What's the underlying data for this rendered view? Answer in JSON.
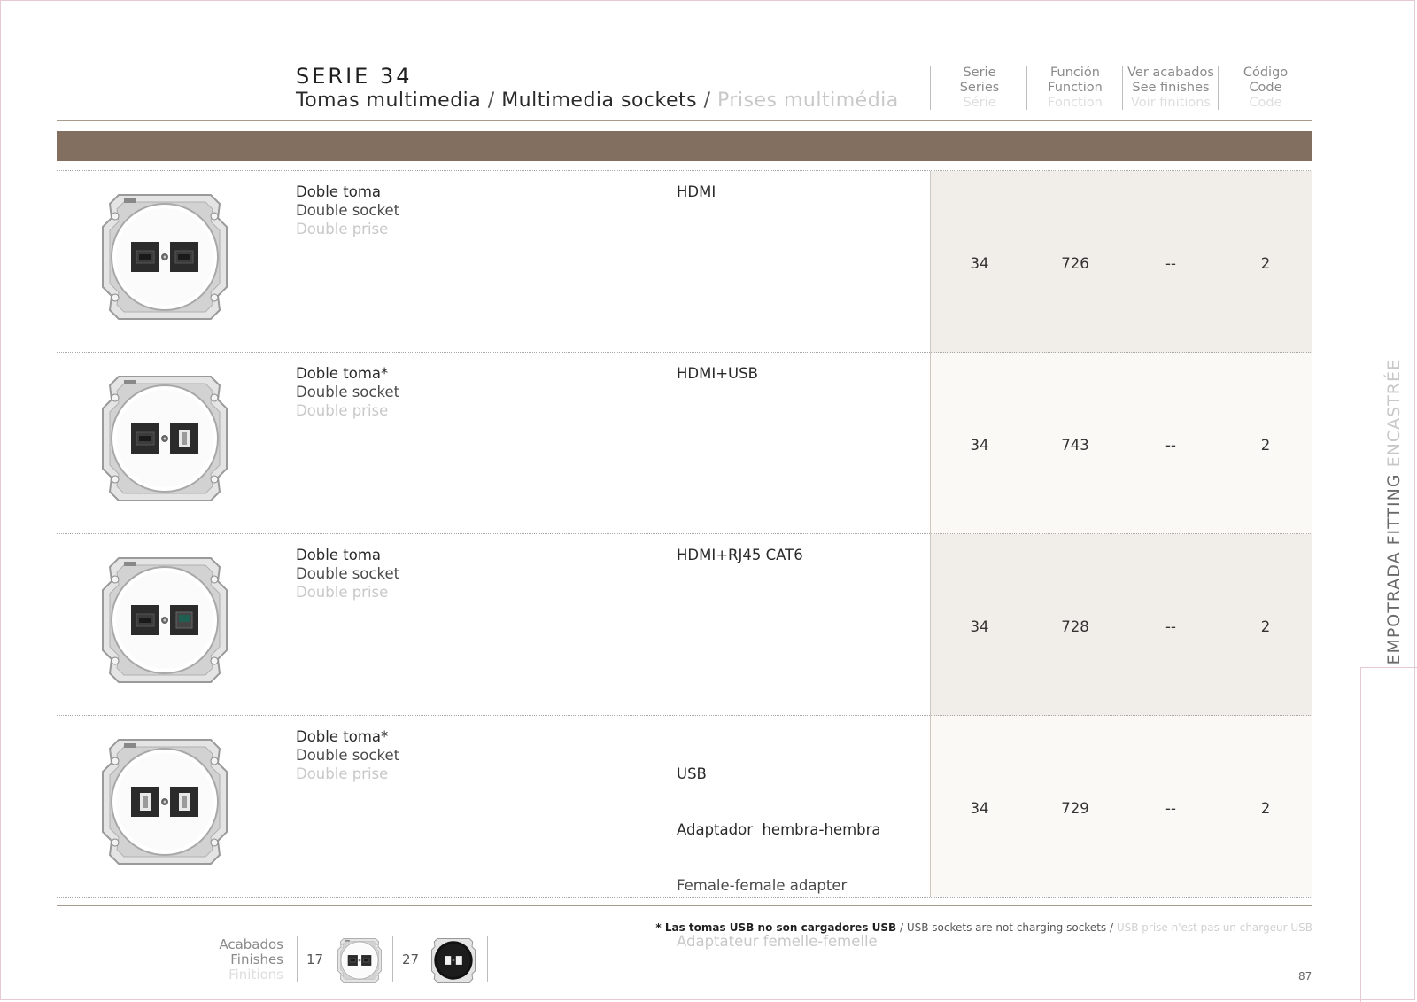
{
  "header": {
    "serie": "SERIE 34",
    "subtitle_es": "Tomas multimedia",
    "subtitle_en": "Multimedia sockets",
    "subtitle_fr": "Prises multimédia",
    "separator": "/",
    "columns": [
      {
        "l1": "Serie",
        "l2": "Series",
        "l3": "Série"
      },
      {
        "l1": "Función",
        "l2": "Function",
        "l3": "Fonction"
      },
      {
        "l1": "Ver acabados",
        "l2": "See finishes",
        "l3": "Voir finitions"
      },
      {
        "l1": "Código",
        "l2": "Code",
        "l3": "Code"
      }
    ]
  },
  "rows": [
    {
      "desc_es": "Doble toma",
      "desc_en": "Double socket",
      "desc_fr": "Double prise",
      "func_l1": "HDMI",
      "func_l2": "",
      "func_l3": "",
      "func_l4": "",
      "serie": "34",
      "funcion": "726",
      "acabados": "--",
      "codigo": "2"
    },
    {
      "desc_es": "Doble toma*",
      "desc_en": "Double socket",
      "desc_fr": "Double prise",
      "func_l1": "HDMI+USB",
      "func_l2": "",
      "func_l3": "",
      "func_l4": "",
      "serie": "34",
      "funcion": "743",
      "acabados": "--",
      "codigo": "2"
    },
    {
      "desc_es": "Doble toma",
      "desc_en": "Double socket",
      "desc_fr": "Double prise",
      "func_l1": "HDMI+RJ45 CAT6",
      "func_l2": "",
      "func_l3": "",
      "func_l4": "",
      "serie": "34",
      "funcion": "728",
      "acabados": "--",
      "codigo": "2"
    },
    {
      "desc_es": "Doble toma*",
      "desc_en": "Double socket",
      "desc_fr": "Double prise",
      "func_l1": "USB",
      "func_l2": "Adaptador  hembra-hembra",
      "func_l3": "Female-female adapter",
      "func_l4": "Adaptateur femelle-femelle",
      "serie": "34",
      "funcion": "729",
      "acabados": "--",
      "codigo": "2"
    }
  ],
  "footer": {
    "note_es": "* Las tomas USB no son cargadores USB",
    "note_en": "USB sockets are not charging sockets",
    "note_fr": "USB prise n'est pas un chargeur USB",
    "note_sep": " / ",
    "finishes_l1": "Acabados",
    "finishes_l2": "Finishes",
    "finishes_l3": "Finitions",
    "finish_codes": [
      "17",
      "27"
    ],
    "page_number": "87"
  },
  "side": {
    "label_a": "EMPOTRADA FITTING",
    "label_b": " ENCASTRÉE"
  },
  "colors": {
    "band": "#836f60",
    "shade_dark": "#f1ede8",
    "shade_light": "#faf9f6"
  }
}
